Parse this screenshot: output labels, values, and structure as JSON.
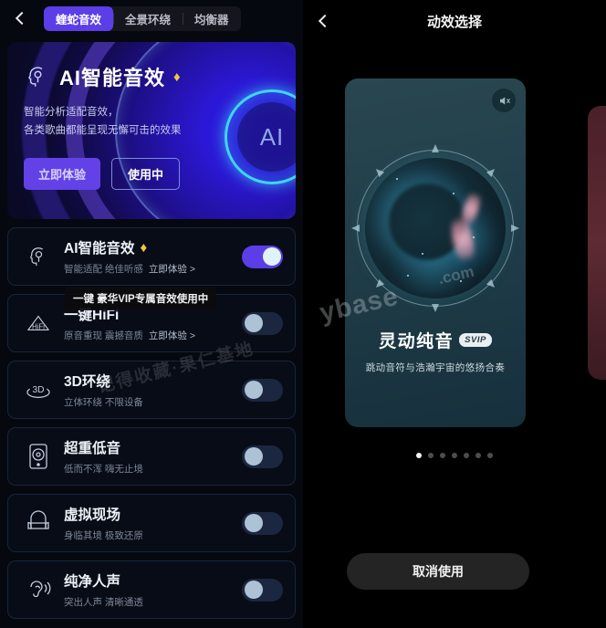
{
  "left": {
    "back_icon": "chevron-left-icon",
    "tabs": [
      {
        "label": "蝰蛇音效",
        "active": true
      },
      {
        "label": "全景环绕",
        "active": false
      },
      {
        "label": "均衡器",
        "active": false
      }
    ],
    "hero": {
      "icon": "ai-brain-icon",
      "title": "AI智能音效",
      "badge_icon": "diamond-icon",
      "badge_glyph": "♦",
      "sub_line1": "智能分析适配音效，",
      "sub_line2": "各类歌曲都能呈现无懈可击的效果",
      "primary_button": "立即体验",
      "outline_button": "使用中",
      "ring_label": "AI"
    },
    "tooltip": {
      "text": "一键  豪华VIP专属音效使用中",
      "glyph": "♦"
    },
    "rows": [
      {
        "icon": "ai-brain-icon",
        "title": "AI智能音效",
        "badge_glyph": "♦",
        "sub": "智能适配 绝佳听感",
        "link": "立即体验 >",
        "toggle_on": true
      },
      {
        "icon": "hifi-icon",
        "title": "一键HiFi",
        "badge_glyph": "",
        "sub": "原音重现 震撼音质",
        "link": "立即体验 >",
        "toggle_on": false
      },
      {
        "icon": "3d-surround-icon",
        "title": "3D环绕",
        "badge_glyph": "",
        "sub": "立体环绕 不限设备",
        "link": "",
        "toggle_on": false
      },
      {
        "icon": "subwoofer-icon",
        "title": "超重低音",
        "badge_glyph": "",
        "sub": "低而不浑 嗨无止境",
        "link": "",
        "toggle_on": false
      },
      {
        "icon": "armchair-icon",
        "title": "虚拟现场",
        "badge_glyph": "",
        "sub": "身临其境 极致还原",
        "link": "",
        "toggle_on": false
      },
      {
        "icon": "ear-icon",
        "title": "纯净人声",
        "badge_glyph": "",
        "sub": "突出人声 清晰通透",
        "link": "",
        "toggle_on": false
      }
    ],
    "watermark": "记得收藏·果仁基地"
  },
  "right": {
    "back_icon": "chevron-left-icon",
    "title": "动效选择",
    "mute_icon": "speaker-mute-icon",
    "card": {
      "effect_title": "灵动纯音",
      "vip_badge": "SVIP",
      "effect_sub": "跳动音符与浩瀚宇宙的悠扬合奏"
    },
    "dots_total": 7,
    "dots_active_index": 0,
    "cancel_button": "取消使用",
    "watermark": "ybase",
    "watermark2": ".com"
  },
  "colors": {
    "accent_purple": "#5b3ee8",
    "hero_ring_cyan": "#3fd5f5",
    "toggle_off_track": "#1b2740",
    "toggle_knob": "#adc2d4",
    "card_teal": "#23414c",
    "svip_badge_bg": "#e9eef2"
  }
}
